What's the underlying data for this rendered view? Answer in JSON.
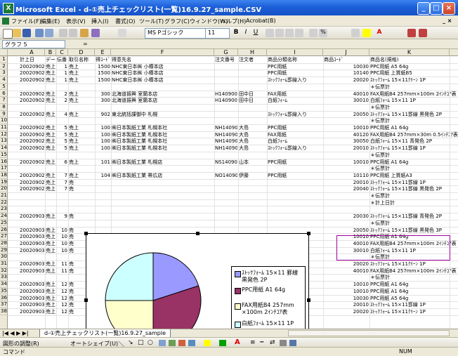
{
  "window": {
    "title": "Microsoft Excel - d-①売上チェックリスト(一覧)16.9.27_sample.CSV"
  },
  "menu": [
    "ファイル(F)",
    "編集(E)",
    "表示(V)",
    "挿入(I)",
    "書式(O)",
    "ツール(T)",
    "グラフ(C)",
    "ウィンドウ(W)",
    "ヘルプ(H)",
    "Acrobat(B)"
  ],
  "toolbar": {
    "font_name": "MS Pゴシック",
    "font_size": "11"
  },
  "namebox": "グラフ 5",
  "columns": [
    "A",
    "B",
    "C",
    "D",
    "E",
    "F",
    "G",
    "H",
    "I",
    "J",
    "K"
  ],
  "headers": [
    "計上日",
    "データ",
    "伝番",
    "取引名称",
    "得ｺｰﾄﾞ",
    "得意先名",
    "注文番号",
    "注文者",
    "商品分類名称",
    "商品ｺｰﾄﾞ",
    "商品名(規格)"
  ],
  "rows": [
    {
      "n": "2",
      "c": [
        "20020902",
        "売上",
        "1",
        "売上",
        "1500",
        "NHC東日本㈱ 小樽本店",
        "",
        "",
        "PPC用紙",
        "10030",
        "PPC用紙 A5 64g"
      ]
    },
    {
      "n": "3",
      "c": [
        "20020902",
        "売上",
        "1",
        "売上",
        "1500",
        "NHC東日本㈱ 小樽本店",
        "",
        "",
        "PPC用紙",
        "10140",
        "PPC用紙 上質紙B5"
      ]
    },
    {
      "n": "4",
      "c": [
        "20020902",
        "売上",
        "1",
        "売上",
        "1500",
        "NHC東日本㈱ 小樽本店",
        "",
        "",
        "ｽﾄｯｸﾌｫｰﾑ罫線入り",
        "20020",
        "ｽﾄｯｸﾌｫｰﾑ 15×11ｸﾘｰﾝ 1P"
      ]
    },
    {
      "n": "5",
      "c": [
        "",
        "",
        "",
        "",
        "",
        "",
        "",
        "",
        "",
        "",
        "＊伝票計"
      ]
    },
    {
      "n": "6",
      "c": [
        "20020902",
        "売上",
        "2",
        "売上",
        "300",
        "北海道振興 室蘭本店",
        "H14090001",
        "田中日",
        "FAX用紙",
        "40010",
        "FAX用紙B4 257mm×100m 2ｲﾝﾁｺｱ表"
      ]
    },
    {
      "n": "7",
      "c": [
        "20020902",
        "売上",
        "2",
        "売上",
        "300",
        "北海道振興 室蘭本店",
        "H14090001",
        "田中日",
        "白紙ﾌｫｰﾑ",
        "30010",
        "白紙ﾌｫｰﾑ 15×11 1P"
      ]
    },
    {
      "n": "8",
      "c": [
        "",
        "",
        "",
        "",
        "",
        "",
        "",
        "",
        "",
        "",
        "＊伝票計"
      ]
    },
    {
      "n": "9",
      "c": [
        "20020902",
        "売上",
        "4",
        "売上",
        "902",
        "東北統括課御中 札幌",
        "",
        "",
        "ｽﾄｯｸﾌｫｰﾑ罫線入り",
        "20050",
        "ｽﾄｯｸﾌｫｰﾑ 15×11罫線 黒発色 2P"
      ]
    },
    {
      "n": "10",
      "c": [
        "",
        "",
        "",
        "",
        "",
        "",
        "",
        "",
        "",
        "",
        "＊伝票計"
      ]
    },
    {
      "n": "11",
      "c": [
        "20020902",
        "売上",
        "5",
        "売上",
        "100",
        "㈱日本製紙工業 札幌本社",
        "NH14090001",
        "大島",
        "PPC用紙",
        "10010",
        "PPC用紙 A1 64g"
      ]
    },
    {
      "n": "12",
      "c": [
        "20020902",
        "売上",
        "5",
        "売上",
        "100",
        "㈱日本製紙工業 札幌本社",
        "NH14090001",
        "大島",
        "FAX用紙",
        "40120",
        "FAX用紙B4 257mm×30m 0.5ｲﾝﾁｺｱ表"
      ]
    },
    {
      "n": "13",
      "c": [
        "20020902",
        "売上",
        "5",
        "売上",
        "100",
        "㈱日本製紙工業 札幌本社",
        "NH14090001",
        "大島",
        "白紙ﾌｫｰﾑ",
        "30050",
        "白紙ﾌｫｰﾑ 15×11 青発色 2P"
      ]
    },
    {
      "n": "14",
      "c": [
        "20020902",
        "売上",
        "5",
        "売上",
        "100",
        "㈱日本製紙工業 札幌本社",
        "NH14090001",
        "大島",
        "ｽﾄｯｸﾌｫｰﾑ罫線入り",
        "20010",
        "ｽﾄｯｸﾌｫｰﾑ 15×11罫線 1P"
      ]
    },
    {
      "n": "15",
      "c": [
        "",
        "",
        "",
        "",
        "",
        "",
        "",
        "",
        "",
        "",
        "＊伝票計"
      ]
    },
    {
      "n": "16",
      "c": [
        "20020902",
        "売上",
        "6",
        "売上",
        "101",
        "㈱日本製紙工業 札幌店",
        "NS14090001",
        "山本",
        "PPC用紙",
        "10010",
        "PPC用紙 A1 64g"
      ]
    },
    {
      "n": "17",
      "c": [
        "",
        "",
        "",
        "",
        "",
        "",
        "",
        "",
        "",
        "",
        "＊伝票計"
      ]
    },
    {
      "n": "18",
      "c": [
        "20020902",
        "売上",
        "7",
        "売上",
        "104",
        "㈱日本製紙工業 帯広店",
        "NO14090001",
        "伊藤",
        "PPC用紙",
        "10110",
        "PPC用紙 上質紙A3"
      ]
    },
    {
      "n": "19",
      "c": [
        "20020902",
        "売上",
        "7",
        "売",
        "",
        "",
        "",
        "",
        "",
        "20010",
        "ｽﾄｯｸﾌｫｰﾑ 15×11罫線 1P"
      ]
    },
    {
      "n": "20",
      "c": [
        "20020902",
        "売上",
        "7",
        "売",
        "",
        "",
        "",
        "",
        "",
        "20040",
        "ｽﾄｯｸﾌｫｰﾑ 15×11罫線 黒発色 2P"
      ]
    },
    {
      "n": "21",
      "c": [
        "",
        "",
        "",
        "",
        "",
        "",
        "",
        "",
        "",
        "",
        "＊伝票計"
      ]
    },
    {
      "n": "22",
      "c": [
        "",
        "",
        "",
        "",
        "",
        "",
        "",
        "",
        "",
        "",
        "＊計上日計"
      ]
    },
    {
      "n": "23",
      "c": [
        "",
        "",
        "",
        "",
        "",
        "",
        "",
        "",
        "",
        "",
        ""
      ]
    },
    {
      "n": "24",
      "c": [
        "20020903",
        "売上",
        "9",
        "売",
        "",
        "",
        "",
        "",
        "",
        "20030",
        "ｽﾄｯｸﾌｫｰﾑ 15×11罫線 青発色 2P"
      ]
    },
    {
      "n": "25",
      "c": [
        "",
        "",
        "",
        "",
        "",
        "",
        "",
        "",
        "",
        "",
        "＊伝票計"
      ]
    },
    {
      "n": "26",
      "c": [
        "20020903",
        "売上",
        "10",
        "売",
        "",
        "",
        "",
        "",
        "",
        "20050",
        "ｽﾄｯｸﾌｫｰﾑ 15×11罫線 黒発色 3P"
      ]
    },
    {
      "n": "27",
      "c": [
        "20020903",
        "売上",
        "10",
        "売",
        "",
        "",
        "",
        "",
        "",
        "10010",
        "PPC用紙 A1 64g"
      ]
    },
    {
      "n": "28",
      "c": [
        "20020903",
        "売上",
        "10",
        "売",
        "",
        "",
        "",
        "",
        "",
        "40010",
        "FAX用紙B4 257mm×100m 2ｲﾝﾁｺｱ表"
      ]
    },
    {
      "n": "29",
      "c": [
        "20020903",
        "売上",
        "10",
        "売",
        "",
        "",
        "",
        "",
        "",
        "30010",
        "白紙ﾌｫｰﾑ 15×11 1P"
      ]
    },
    {
      "n": "30",
      "c": [
        "",
        "",
        "",
        "",
        "",
        "",
        "",
        "",
        "",
        "",
        "＊伝票計"
      ]
    },
    {
      "n": "31",
      "c": [
        "20020903",
        "売上",
        "11",
        "売",
        "",
        "",
        "",
        "",
        "",
        "20020",
        "ｽﾄｯｸﾌｫｰﾑ 15×11ｸﾘｰﾝ 1P"
      ]
    },
    {
      "n": "32",
      "c": [
        "20020903",
        "売上",
        "11",
        "売",
        "",
        "",
        "",
        "",
        "",
        "40010",
        "FAX用紙B4 257mm×100m 2ｲﾝﾁｺｱ表"
      ]
    },
    {
      "n": "33",
      "c": [
        "",
        "",
        "",
        "",
        "",
        "",
        "",
        "",
        "",
        "",
        "＊伝票計"
      ]
    },
    {
      "n": "34",
      "c": [
        "20020903",
        "売上",
        "12",
        "売",
        "",
        "",
        "",
        "",
        "",
        "10010",
        "PPC用紙 A1 64g"
      ]
    },
    {
      "n": "35",
      "c": [
        "20020903",
        "売上",
        "12",
        "売",
        "",
        "",
        "",
        "",
        "",
        "10010",
        "PPC用紙 A1 64g"
      ]
    },
    {
      "n": "36",
      "c": [
        "20020903",
        "売上",
        "12",
        "売",
        "",
        "",
        "",
        "",
        "",
        "10030",
        "PPC用紙 A5 64g"
      ]
    },
    {
      "n": "37",
      "c": [
        "20020903",
        "売上",
        "12",
        "売",
        "",
        "",
        "",
        "",
        "",
        "20010",
        "ｽﾄｯｸﾌｫｰﾑ 15×11罫線 1P"
      ]
    },
    {
      "n": "38",
      "c": [
        "20020903",
        "売上",
        "12",
        "売",
        "",
        "",
        "",
        "",
        "",
        "20020",
        "ｽﾄｯｸﾌｫｰﾑ 15×11ｸﾘｰﾝ 1P"
      ]
    }
  ],
  "chart_data": {
    "type": "pie",
    "title": "",
    "categories": [
      "ｽﾄｯｸﾌｫｰﾑ 15×11 罫線 黒発色 2P",
      "PPC用紙 A1 64g",
      "FAX用紙B4 257mm ×100m 2ｲﾝﾁｺｱ表",
      "白紙ﾌｫｰﾑ 15×11 1P"
    ],
    "values": [
      20,
      30,
      25,
      25
    ],
    "colors": [
      "#9999ff",
      "#993366",
      "#ffffcc",
      "#ccffff"
    ],
    "legend": "right"
  },
  "sheet_tab": "d-①売上チェックリスト(一覧)16.9.27_sample",
  "drawbar": {
    "draw_label": "図形の調整(R)",
    "autoshape_label": "オートシェイプ(U)"
  },
  "status": {
    "left": "コマンド",
    "right": "NUM"
  }
}
